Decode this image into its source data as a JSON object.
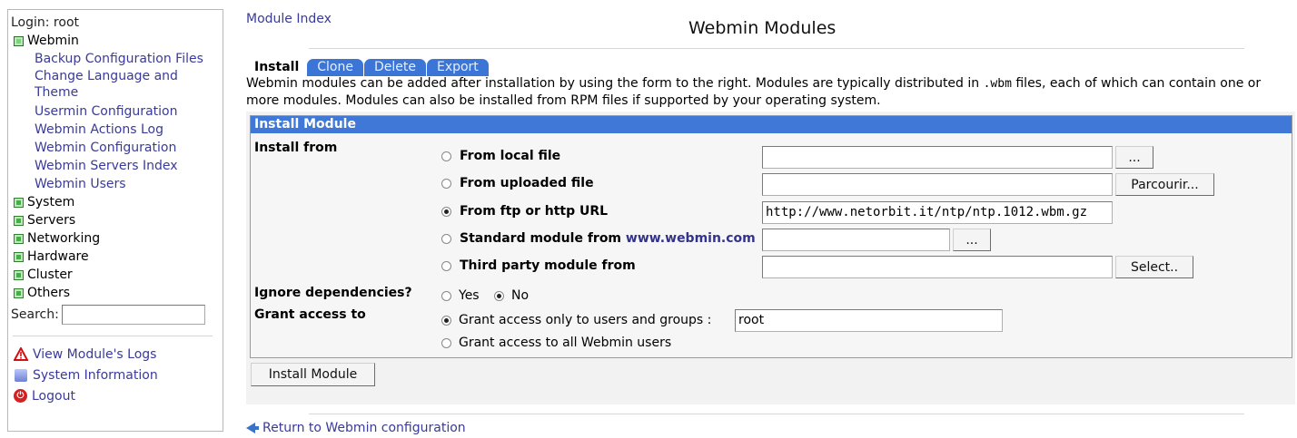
{
  "sidebar": {
    "login": "Login: root",
    "categories": [
      {
        "label": "Webmin",
        "icon": "folder-open-icon"
      },
      {
        "label": "System",
        "icon": "folder-icon"
      },
      {
        "label": "Servers",
        "icon": "folder-icon"
      },
      {
        "label": "Networking",
        "icon": "folder-icon"
      },
      {
        "label": "Hardware",
        "icon": "folder-icon"
      },
      {
        "label": "Cluster",
        "icon": "folder-icon"
      },
      {
        "label": "Others",
        "icon": "folder-icon"
      }
    ],
    "webmin_items": [
      "Backup Configuration Files",
      "Change Language and Theme",
      "Usermin Configuration",
      "Webmin Actions Log",
      "Webmin Configuration",
      "Webmin Servers Index",
      "Webmin Users"
    ],
    "search_label": "Search:",
    "search_value": "",
    "links": {
      "logs": "View Module's Logs",
      "sysinfo": "System Information",
      "logout": "Logout"
    }
  },
  "header": {
    "module_index": "Module Index",
    "title": "Webmin Modules"
  },
  "tabs": [
    "Install",
    "Clone",
    "Delete",
    "Export"
  ],
  "intro": {
    "part1": "Webmin modules can be added after installation by using the form to the right. Modules are typically distributed in ",
    "code": ".wbm",
    "part2": " files, each of which can contain one or more modules. Modules can also be installed from RPM files if supported by your operating system."
  },
  "form": {
    "header": "Install Module",
    "install_from_label": "Install from",
    "options": {
      "local": "From local file",
      "uploaded": "From uploaded file",
      "url": "From ftp or http URL",
      "standard_prefix": "Standard module from ",
      "standard_link": "www.webmin.com",
      "third_party": "Third party module from"
    },
    "values": {
      "local": "",
      "uploaded": "",
      "url": "http://www.netorbit.it/ntp/ntp.1012.wbm.gz",
      "standard": "",
      "third_party": ""
    },
    "buttons": {
      "local_browse": "...",
      "upload_browse": "Parcourir...",
      "standard_browse": "...",
      "third_select": "Select.."
    },
    "ignore_label": "Ignore dependencies?",
    "ignore_yes": "Yes",
    "ignore_no": "No",
    "grant_label": "Grant access to",
    "grant_only": "Grant access only to users and groups :",
    "grant_value": "root",
    "grant_all": "Grant access to all Webmin users",
    "submit": "Install Module"
  },
  "footer": {
    "return": "Return to Webmin configuration"
  },
  "colors": {
    "tab_blue": "#3b76d6",
    "header_blue": "#3f78d6",
    "link": "#3a3a9a"
  }
}
